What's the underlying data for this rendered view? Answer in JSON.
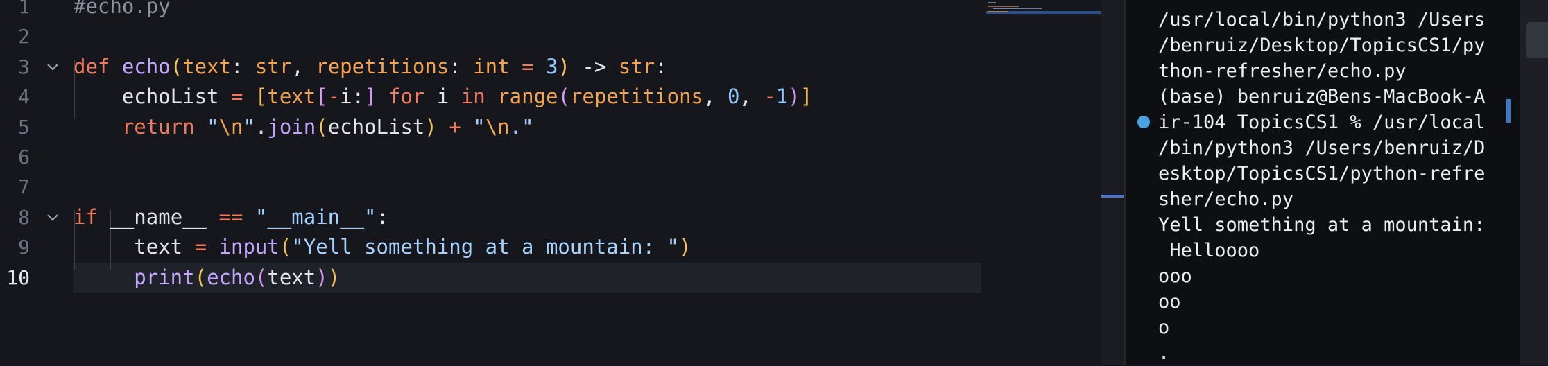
{
  "editor": {
    "lines": [
      {
        "num": "1",
        "tokens": [
          {
            "t": "#echo.py",
            "c": "cm"
          }
        ]
      },
      {
        "num": "2",
        "tokens": []
      },
      {
        "num": "3",
        "tokens": [
          {
            "t": "def ",
            "c": "kw"
          },
          {
            "t": "echo",
            "c": "fn"
          },
          {
            "t": "(",
            "c": "br1"
          },
          {
            "t": "text",
            "c": "par"
          },
          {
            "t": ": ",
            "c": "id"
          },
          {
            "t": "str",
            "c": "ty"
          },
          {
            "t": ", ",
            "c": "id"
          },
          {
            "t": "repetitions",
            "c": "par"
          },
          {
            "t": ": ",
            "c": "id"
          },
          {
            "t": "int",
            "c": "ty"
          },
          {
            "t": " = ",
            "c": "op"
          },
          {
            "t": "3",
            "c": "num"
          },
          {
            "t": ")",
            "c": "br1"
          },
          {
            "t": " -> ",
            "c": "id"
          },
          {
            "t": "str",
            "c": "ty"
          },
          {
            "t": ":",
            "c": "id"
          }
        ]
      },
      {
        "num": "4",
        "tokens": [
          {
            "t": "    echoList",
            "c": "id"
          },
          {
            "t": " = ",
            "c": "op"
          },
          {
            "t": "[",
            "c": "br1"
          },
          {
            "t": "text",
            "c": "par"
          },
          {
            "t": "[",
            "c": "br2"
          },
          {
            "t": "-",
            "c": "op"
          },
          {
            "t": "i:",
            "c": "id"
          },
          {
            "t": "]",
            "c": "br2"
          },
          {
            "t": " for ",
            "c": "kw"
          },
          {
            "t": "i ",
            "c": "id"
          },
          {
            "t": "in ",
            "c": "kw"
          },
          {
            "t": "range",
            "c": "ty"
          },
          {
            "t": "(",
            "c": "br2"
          },
          {
            "t": "repetitions",
            "c": "par"
          },
          {
            "t": ", ",
            "c": "id"
          },
          {
            "t": "0",
            "c": "num"
          },
          {
            "t": ", ",
            "c": "id"
          },
          {
            "t": "-",
            "c": "op"
          },
          {
            "t": "1",
            "c": "num"
          },
          {
            "t": ")",
            "c": "br2"
          },
          {
            "t": "]",
            "c": "br1"
          }
        ]
      },
      {
        "num": "5",
        "tokens": [
          {
            "t": "    return ",
            "c": "kw"
          },
          {
            "t": "\"",
            "c": "str"
          },
          {
            "t": "\\n",
            "c": "ty"
          },
          {
            "t": "\"",
            "c": "str"
          },
          {
            "t": ".",
            "c": "id"
          },
          {
            "t": "join",
            "c": "fn"
          },
          {
            "t": "(",
            "c": "br1"
          },
          {
            "t": "echoList",
            "c": "id"
          },
          {
            "t": ")",
            "c": "br1"
          },
          {
            "t": " + ",
            "c": "op"
          },
          {
            "t": "\"",
            "c": "str"
          },
          {
            "t": "\\n",
            "c": "ty"
          },
          {
            "t": ".\"",
            "c": "str"
          }
        ]
      },
      {
        "num": "6",
        "tokens": []
      },
      {
        "num": "7",
        "tokens": []
      },
      {
        "num": "8",
        "tokens": [
          {
            "t": "if ",
            "c": "kw"
          },
          {
            "t": "__name__",
            "c": "id"
          },
          {
            "t": " == ",
            "c": "op"
          },
          {
            "t": "\"__main__\"",
            "c": "str"
          },
          {
            "t": ":",
            "c": "id"
          }
        ]
      },
      {
        "num": "9",
        "tokens": [
          {
            "t": "     text",
            "c": "id"
          },
          {
            "t": " = ",
            "c": "op"
          },
          {
            "t": "input",
            "c": "fn"
          },
          {
            "t": "(",
            "c": "br1"
          },
          {
            "t": "\"Yell something at a mountain: \"",
            "c": "str"
          },
          {
            "t": ")",
            "c": "br1"
          }
        ]
      },
      {
        "num": "10",
        "tokens": [
          {
            "t": "     print",
            "c": "fn"
          },
          {
            "t": "(",
            "c": "br1"
          },
          {
            "t": "echo",
            "c": "fn"
          },
          {
            "t": "(",
            "c": "br2"
          },
          {
            "t": "text",
            "c": "id"
          },
          {
            "t": ")",
            "c": "br2"
          },
          {
            "t": ")",
            "c": "br1"
          }
        ]
      }
    ],
    "active_line": "10",
    "fold_lines": [
      "3",
      "8"
    ]
  },
  "terminal": {
    "lines": [
      "/usr/local/bin/python3 /Users",
      "/benruiz/Desktop/TopicsCS1/py",
      "thon-refresher/echo.py",
      "(base) benruiz@Bens-MacBook-A",
      "ir-104 TopicsCS1 % /usr/local",
      "/bin/python3 /Users/benruiz/D",
      "esktop/TopicsCS1/python-refre",
      "sher/echo.py",
      "Yell something at a mountain:",
      " Helloooo",
      "ooo",
      "oo",
      "o",
      "."
    ]
  },
  "colors": {
    "keyword": "#f07a5d",
    "function": "#c3a6ff",
    "type": "#f6a350",
    "string": "#a6d2ff",
    "number": "#8fc7ff",
    "comment": "#8b929e",
    "accent": "#4aa3df"
  }
}
